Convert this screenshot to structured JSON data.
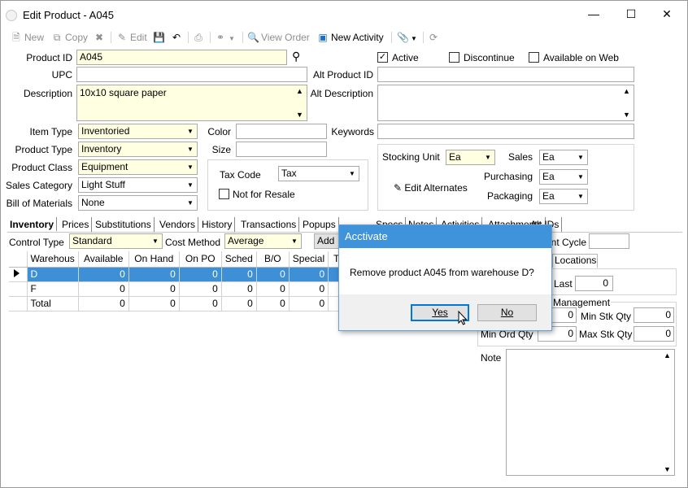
{
  "window": {
    "title": "Edit Product - A045"
  },
  "toolbar": {
    "new": "New",
    "copy": "Copy",
    "edit": "Edit",
    "view_order": "View Order",
    "new_activity": "New Activity"
  },
  "form": {
    "product_id_label": "Product ID",
    "product_id": "A045",
    "upc_label": "UPC",
    "upc": "",
    "description_label": "Description",
    "description": "10x10 square paper",
    "active_label": "Active",
    "active": true,
    "discontinue_label": "Discontinue",
    "discontinue": false,
    "available_web_label": "Available on Web",
    "available_web": false,
    "alt_product_id_label": "Alt Product ID",
    "alt_product_id": "",
    "alt_description_label": "Alt Description",
    "alt_description": "",
    "item_type_label": "Item Type",
    "item_type": "Inventoried",
    "product_type_label": "Product Type",
    "product_type": "Inventory",
    "product_class_label": "Product Class",
    "product_class": "Equipment",
    "sales_category_label": "Sales Category",
    "sales_category": "Light Stuff",
    "bom_label": "Bill of Materials",
    "bom": "None",
    "color_label": "Color",
    "color": "",
    "size_label": "Size",
    "size": "",
    "keywords_label": "Keywords",
    "keywords": "",
    "tax_code_label": "Tax Code",
    "tax_code": "Tax",
    "not_for_resale_label": "Not for Resale",
    "stocking_unit_label": "Stocking Unit",
    "stocking_unit": "Ea",
    "sales_label": "Sales",
    "sales_unit": "Ea",
    "purchasing_label": "Purchasing",
    "purchasing_unit": "Ea",
    "packaging_label": "Packaging",
    "packaging_unit": "Ea",
    "edit_alternates": "Edit Alternates"
  },
  "tabs": [
    "Inventory",
    "Prices",
    "Substitutions",
    "Vendors",
    "History",
    "Transactions",
    "Popups",
    "Specs",
    "Notes",
    "Activities",
    "Attachments",
    "Alt IDs"
  ],
  "inventory": {
    "control_type_label": "Control Type",
    "control_type": "Standard",
    "cost_method_label": "Cost Method",
    "cost_method": "Average",
    "add_button": "Add",
    "count_cycle_label": "Count Cycle",
    "count_cycle": "",
    "locations_tab": "Locations",
    "last_label": "Last",
    "last_value": "0",
    "management_label": "Management",
    "min_stk_qty_label": "Min Stk Qty",
    "min_stk_qty": "0",
    "max_stk_qty_label": "Max Stk Qty",
    "max_stk_qty": "0",
    "min_ord_qty_label": "Min Ord Qty",
    "min_ord_qty": "0",
    "reorder_value": "0",
    "note_label": "Note"
  },
  "grid": {
    "columns": [
      "Warehous",
      "Available",
      "On Hand",
      "On PO",
      "Sched",
      "B/O",
      "Special",
      "T"
    ],
    "rows": [
      [
        "D",
        "0",
        "0",
        "0",
        "0",
        "0",
        "0",
        ""
      ],
      [
        "F",
        "0",
        "0",
        "0",
        "0",
        "0",
        "0",
        ""
      ],
      [
        "Total",
        "0",
        "0",
        "0",
        "0",
        "0",
        "0",
        ""
      ]
    ]
  },
  "dialog": {
    "title": "Acctivate",
    "message": "Remove product A045 from warehouse D?",
    "yes": "Yes",
    "no": "No"
  }
}
